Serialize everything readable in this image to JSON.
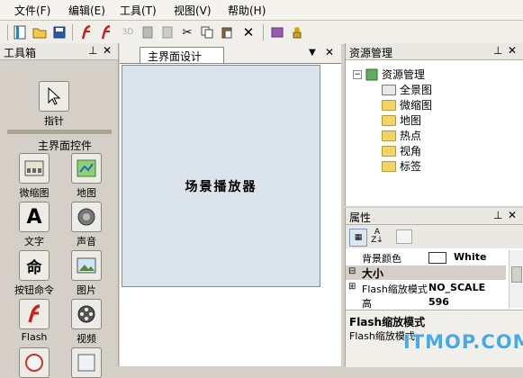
{
  "menu": [
    "文件(F)",
    "编辑(E)",
    "工具(T)",
    "视图(V)",
    "帮助(H)"
  ],
  "toolbox": {
    "title": "工具箱",
    "pointer_label": "指针",
    "section_label": "主界面控件",
    "tools": [
      "微缩图",
      "地图",
      "文字",
      "声音",
      "按钮命令",
      "图片",
      "Flash",
      "视频"
    ]
  },
  "editor": {
    "tab_label": "主界面设计",
    "canvas_text": "场景播放器"
  },
  "resource_manager": {
    "title": "资源管理",
    "root": "资源管理",
    "items": [
      "全景图",
      "微缩图",
      "地图",
      "热点",
      "视角",
      "标签"
    ]
  },
  "properties": {
    "title": "属性",
    "rows": [
      {
        "name": "背景颜色",
        "value": "White"
      },
      {
        "name": "大小",
        "value": ""
      },
      {
        "name": "Flash缩放模式",
        "value": "NO_SCALE"
      },
      {
        "name": "高",
        "value": "596"
      }
    ],
    "desc_title": "Flash缩放模式",
    "desc_text": "Flash缩放模式"
  },
  "watermark": "ITMOP.COM",
  "colors": {
    "canvas_bg": "#dbe3eb",
    "panel_bg": "#d4d0c8",
    "watermark": "#49a9e8"
  }
}
